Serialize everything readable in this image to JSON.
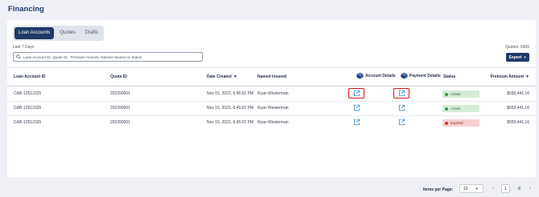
{
  "page": {
    "title": "Financing"
  },
  "tabs": [
    {
      "label": "Loan Accounts",
      "active": true
    },
    {
      "label": "Quotes",
      "active": false
    },
    {
      "label": "Drafts",
      "active": false
    }
  ],
  "filter": {
    "range_label": "Last 7 Days",
    "quotes_count": "Quotes: 5000"
  },
  "search": {
    "placeholder": "Loan Account ID, Quote ID,  Premium Amount, Named Insured or Status"
  },
  "export": {
    "label": "Export"
  },
  "table": {
    "headers": {
      "loan_account_id": "Loan Account ID",
      "quote_id": "Quote ID",
      "date_created": "Date Created",
      "named_insured": "Named Insured",
      "account_details": "Account Details",
      "payment_details": "Payment Details",
      "status": "Status",
      "premium_amount": "Premium Amount"
    },
    "rows": [
      {
        "loan_account_id": "CAB-12512325",
        "quote_id": "202200001",
        "date_created": "Nov 15, 2022, 6:45:02 PM",
        "named_insured": "Ryan Westerman",
        "status": "Active",
        "status_type": "active",
        "premium_amount": "$550,441.16",
        "highlighted": true
      },
      {
        "loan_account_id": "CAB-12512325",
        "quote_id": "202200001",
        "date_created": "Nov 15, 2022, 6:45:02 PM",
        "named_insured": "Ryan Westerman",
        "status": "Active",
        "status_type": "active",
        "premium_amount": "$550,441.16",
        "highlighted": false
      },
      {
        "loan_account_id": "CAB-12512325",
        "quote_id": "202200001",
        "date_created": "Nov 15, 2022, 6:45:02 PM",
        "named_insured": "Ryan Westerman",
        "status": "Expired",
        "status_type": "expired",
        "premium_amount": "$550,441.16",
        "highlighted": false
      }
    ]
  },
  "pagination": {
    "items_per_page_label": "Items per Page:",
    "items_per_page_value": "10",
    "pages": [
      "1",
      "8"
    ],
    "current_page": "1"
  },
  "colors": {
    "primary": "#1f3a68",
    "highlight": "#d0161f",
    "active_bg": "#d5ecd7",
    "expired_bg": "#f6d1d1",
    "link_icon": "#4a90d9"
  },
  "icons": {
    "search": "search-icon",
    "external_link": "external-link-icon",
    "details_cube": "cube-icon",
    "sort": "sort-down-icon",
    "chevron_left": "chevron-left-icon",
    "chevron_right": "chevron-right-icon"
  }
}
